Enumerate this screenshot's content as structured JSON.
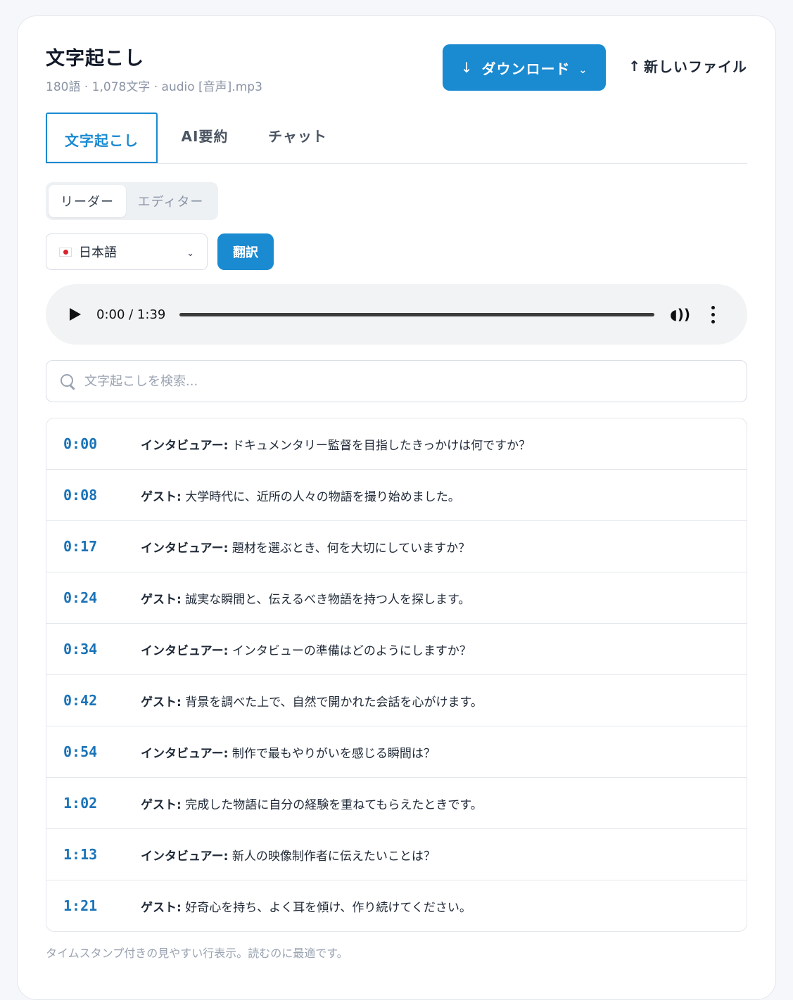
{
  "header": {
    "title": "文字起こし",
    "subtitle": "180語 · 1,078文字 · audio [音声].mp3",
    "download_label": "ダウンロード",
    "download_icon": "↓",
    "new_file_label": "新しいファイル",
    "new_file_icon": "↑"
  },
  "tabs": [
    {
      "label": "文字起こし",
      "active": true
    },
    {
      "label": "AI要約",
      "active": false
    },
    {
      "label": "チャット",
      "active": false
    }
  ],
  "view_mode": {
    "reader": "リーダー",
    "editor": "エディター",
    "selected": "reader"
  },
  "language": {
    "selected": "日本語",
    "translate_label": "翻訳"
  },
  "player": {
    "time": "0:00 / 1:39",
    "progress": 0
  },
  "search": {
    "placeholder": "文字起こしを検索..."
  },
  "transcript": [
    {
      "time": "0:00",
      "speaker": "インタビュアー:",
      "text": " ドキュメンタリー監督を目指したきっかけは何ですか？"
    },
    {
      "time": "0:08",
      "speaker": "ゲスト:",
      "text": " 大学時代に、近所の人々の物語を撮り始めました。"
    },
    {
      "time": "0:17",
      "speaker": "インタビュアー:",
      "text": " 題材を選ぶとき、何を大切にしていますか？"
    },
    {
      "time": "0:24",
      "speaker": "ゲスト:",
      "text": " 誠実な瞬間と、伝えるべき物語を持つ人を探します。"
    },
    {
      "time": "0:34",
      "speaker": "インタビュアー:",
      "text": " インタビューの準備はどのようにしますか？"
    },
    {
      "time": "0:42",
      "speaker": "ゲスト:",
      "text": " 背景を調べた上で、自然で開かれた会話を心がけます。"
    },
    {
      "time": "0:54",
      "speaker": "インタビュアー:",
      "text": " 制作で最もやりがいを感じる瞬間は？"
    },
    {
      "time": "1:02",
      "speaker": "ゲスト:",
      "text": " 完成した物語に自分の経験を重ねてもらえたときです。"
    },
    {
      "time": "1:13",
      "speaker": "インタビュアー:",
      "text": " 新人の映像制作者に伝えたいことは？"
    },
    {
      "time": "1:21",
      "speaker": "ゲスト:",
      "text": " 好奇心を持ち、よく耳を傾け、作り続けてください。"
    }
  ],
  "footer_note": "タイムスタンプ付きの見やすい行表示。読むのに最適です。",
  "colors": {
    "accent": "#1a8ad1",
    "timestamp": "#1a73b8"
  }
}
